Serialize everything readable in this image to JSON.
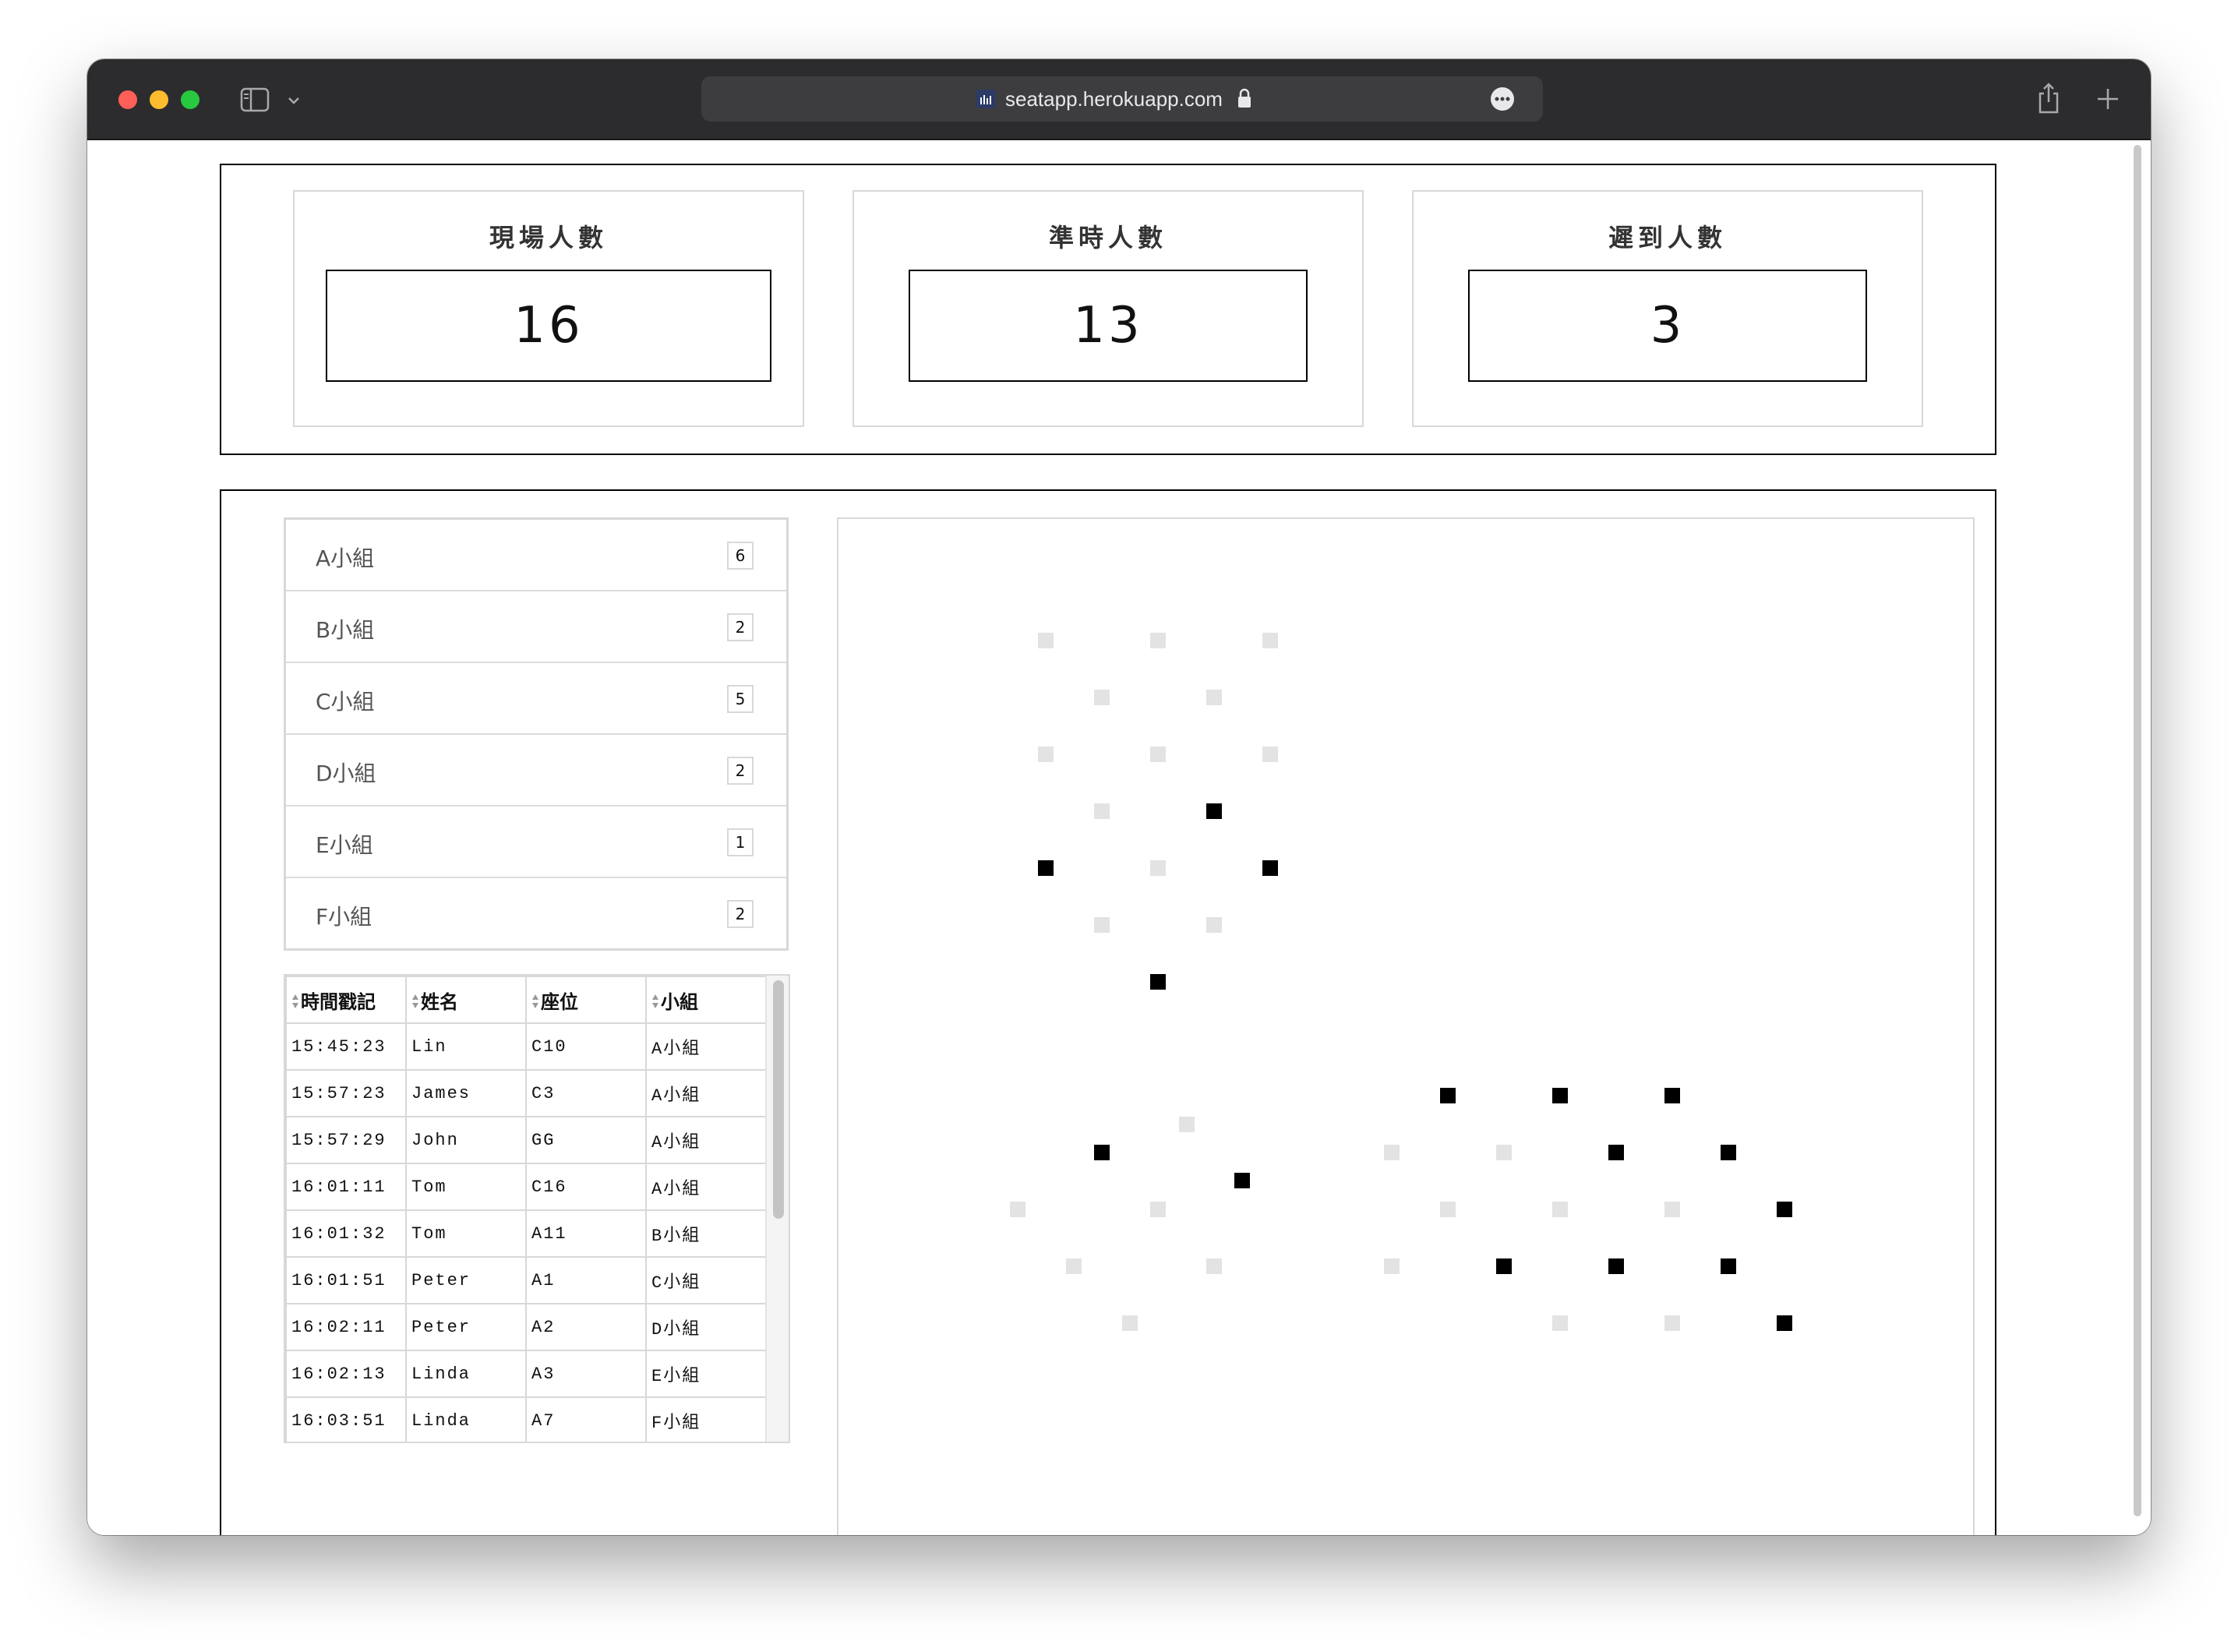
{
  "browser": {
    "url": "seatapp.herokuapp.com"
  },
  "stats": {
    "present": {
      "label": "現場人數",
      "value": "16"
    },
    "ontime": {
      "label": "準時人數",
      "value": "13"
    },
    "late": {
      "label": "遲到人數",
      "value": "3"
    }
  },
  "groups": [
    {
      "label": "A小組",
      "count": "6"
    },
    {
      "label": "B小組",
      "count": "2"
    },
    {
      "label": "C小組",
      "count": "5"
    },
    {
      "label": "D小組",
      "count": "2"
    },
    {
      "label": "E小組",
      "count": "1"
    },
    {
      "label": "F小組",
      "count": "2"
    }
  ],
  "log_table": {
    "headers": [
      "時間戳記",
      "姓名",
      "座位",
      "小組"
    ],
    "rows": [
      [
        "15:45:23",
        "Lin",
        "C10",
        "A小組"
      ],
      [
        "15:57:23",
        "James",
        "C3",
        "A小組"
      ],
      [
        "15:57:29",
        "John",
        "GG",
        "A小組"
      ],
      [
        "16:01:11",
        "Tom",
        "C16",
        "A小組"
      ],
      [
        "16:01:32",
        "Tom",
        "A11",
        "B小組"
      ],
      [
        "16:01:51",
        "Peter",
        "A1",
        "C小組"
      ],
      [
        "16:02:11",
        "Peter",
        "A2",
        "D小組"
      ],
      [
        "16:02:13",
        "Linda",
        "A3",
        "E小組"
      ],
      [
        "16:03:51",
        "Linda",
        "A7",
        "F小組"
      ]
    ]
  },
  "colors": {
    "seat_taken": "#000000",
    "seat_empty": "#e3e3e3"
  },
  "seat_map": {
    "clusters": [
      {
        "seats": [
          {
            "status": "empty"
          },
          {
            "status": "empty"
          },
          {
            "status": "empty"
          },
          {
            "status": "empty"
          },
          {
            "status": "empty"
          },
          {
            "status": "empty"
          },
          {
            "status": "empty"
          },
          {
            "status": "empty"
          },
          {
            "status": "empty"
          },
          {
            "status": "taken"
          },
          {
            "status": "taken"
          },
          {
            "status": "empty"
          },
          {
            "status": "taken"
          },
          {
            "status": "empty"
          },
          {
            "status": "empty"
          },
          {
            "status": "taken"
          }
        ]
      },
      {
        "seats": [
          {
            "status": "empty"
          },
          {
            "status": "taken"
          },
          {
            "status": "taken"
          },
          {
            "status": "empty"
          },
          {
            "status": "empty"
          },
          {
            "status": "empty"
          },
          {
            "status": "empty"
          },
          {
            "status": "empty"
          }
        ]
      },
      {
        "seats": [
          {
            "status": "taken"
          },
          {
            "status": "taken"
          },
          {
            "status": "taken"
          },
          {
            "status": "empty"
          },
          {
            "status": "empty"
          },
          {
            "status": "taken"
          },
          {
            "status": "taken"
          },
          {
            "status": "empty"
          },
          {
            "status": "empty"
          },
          {
            "status": "empty"
          },
          {
            "status": "taken"
          },
          {
            "status": "empty"
          },
          {
            "status": "taken"
          },
          {
            "status": "taken"
          },
          {
            "status": "taken"
          },
          {
            "status": "empty"
          },
          {
            "status": "empty"
          },
          {
            "status": "taken"
          }
        ]
      }
    ]
  }
}
